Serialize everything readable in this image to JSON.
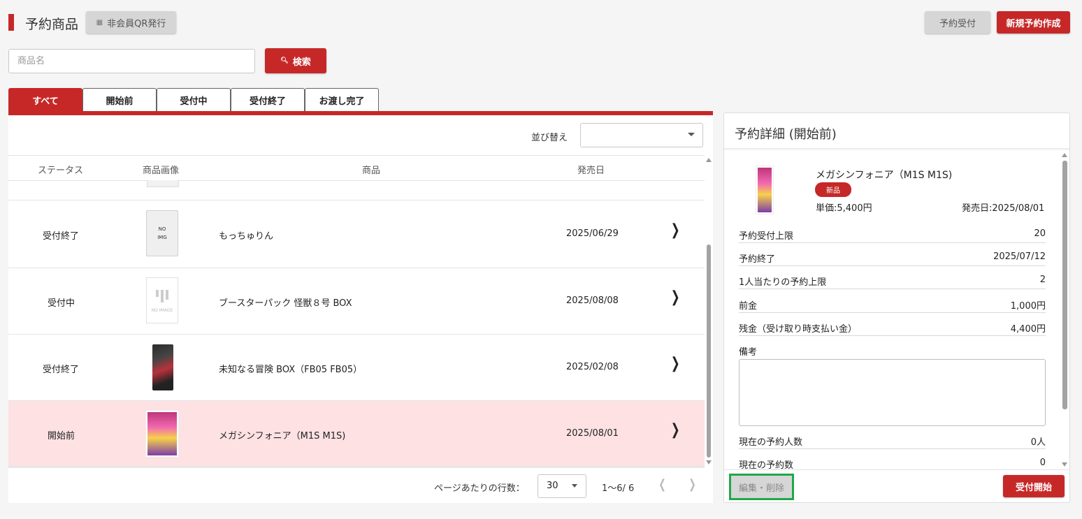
{
  "header": {
    "title": "予約商品",
    "qr_button": "非会員QR発行",
    "accept_button": "予約受付",
    "create_button": "新規予約作成"
  },
  "search": {
    "placeholder": "商品名",
    "value": "",
    "button": "検索"
  },
  "tabs": [
    {
      "label": "すべて",
      "active": true
    },
    {
      "label": "開始前",
      "active": false
    },
    {
      "label": "受付中",
      "active": false
    },
    {
      "label": "受付終了",
      "active": false
    },
    {
      "label": "お渡し完了",
      "active": false
    }
  ],
  "sort": {
    "label": "並び替え",
    "value": ""
  },
  "table": {
    "headers": {
      "status": "ステータス",
      "image": "商品画像",
      "product": "商品",
      "release": "発売日"
    },
    "rows": [
      {
        "status": "受付終了",
        "image": "no-img",
        "image_text": [
          "NO",
          "IMG"
        ],
        "product": "もっちゅりん",
        "release": "2025/06/29",
        "selected": false
      },
      {
        "status": "受付中",
        "image": "no-image",
        "image_text": [
          "NO IMAGE"
        ],
        "product": "ブースターパック 怪獣８号 BOX",
        "release": "2025/08/08",
        "selected": false
      },
      {
        "status": "受付終了",
        "image": "product-box",
        "product": "未知なる冒険 BOX（FB05 FB05）",
        "release": "2025/02/08",
        "selected": false
      },
      {
        "status": "開始前",
        "image": "product-pack",
        "product": "メガシンフォニア（M1S M1S)",
        "release": "2025/08/01",
        "selected": true
      }
    ]
  },
  "pagination": {
    "rows_per_page_label": "ページあたりの行数：",
    "rows_per_page": "30",
    "range": "1〜6/ 6"
  },
  "detail": {
    "title": "予約詳細 (開始前)",
    "product_name": "メガシンフォニア（M1S M1S)",
    "badge": "新品",
    "price": "単価:5,400円",
    "release": "発売日:2025/08/01",
    "fields": [
      {
        "label": "予約受付上限",
        "value": "20"
      },
      {
        "label": "予約終了",
        "value": "2025/07/12"
      },
      {
        "label": "1人当たりの予約上限",
        "value": "2"
      },
      {
        "label": "前金",
        "value": "1,000円"
      },
      {
        "label": "残金（受け取り時支払い金）",
        "value": "4,400円"
      }
    ],
    "memo_label": "備考",
    "memo_value": "",
    "fields_after": [
      {
        "label": "現在の予約人数",
        "value": "0人"
      },
      {
        "label": "現在の予約数",
        "value": "0"
      }
    ],
    "edit_button": "編集・削除",
    "start_button": "受付開始"
  },
  "colors": {
    "accent": "#c62828",
    "selected_row": "#fde1e3",
    "highlight_border": "#1fa84a"
  }
}
